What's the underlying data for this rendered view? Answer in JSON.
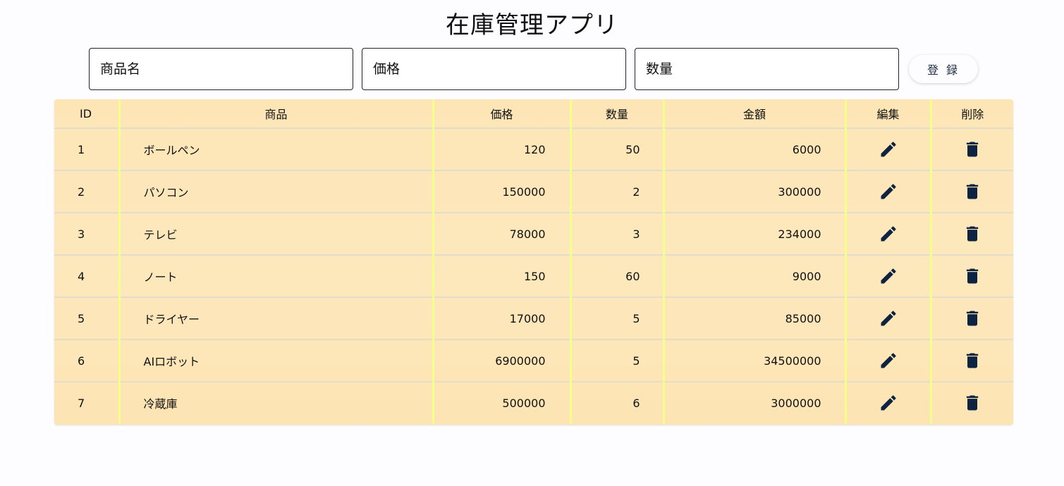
{
  "app": {
    "title": "在庫管理アプリ"
  },
  "form": {
    "name_placeholder": "商品名",
    "price_placeholder": "価格",
    "quantity_placeholder": "数量",
    "register_label": "登 録"
  },
  "table": {
    "headers": {
      "id": "ID",
      "name": "商品",
      "price": "価格",
      "quantity": "数量",
      "amount": "金額",
      "edit": "編集",
      "delete": "削除"
    },
    "rows": [
      {
        "id": "1",
        "name": "ボールペン",
        "price": "120",
        "quantity": "50",
        "amount": "6000"
      },
      {
        "id": "2",
        "name": "パソコン",
        "price": "150000",
        "quantity": "2",
        "amount": "300000"
      },
      {
        "id": "3",
        "name": "テレビ",
        "price": "78000",
        "quantity": "3",
        "amount": "234000"
      },
      {
        "id": "4",
        "name": "ノート",
        "price": "150",
        "quantity": "60",
        "amount": "9000"
      },
      {
        "id": "5",
        "name": "ドライヤー",
        "price": "17000",
        "quantity": "5",
        "amount": "85000"
      },
      {
        "id": "6",
        "name": "AIロボット",
        "price": "6900000",
        "quantity": "5",
        "amount": "34500000"
      },
      {
        "id": "7",
        "name": "冷蔵庫",
        "price": "500000",
        "quantity": "6",
        "amount": "3000000"
      }
    ]
  },
  "icons": {
    "edit": "pencil-icon",
    "delete": "trash-icon"
  },
  "colors": {
    "table_background": "#fde6b8",
    "column_separator": "#f4ff8a",
    "icon_color": "#0d2340",
    "button_text": "#1b2b44"
  }
}
